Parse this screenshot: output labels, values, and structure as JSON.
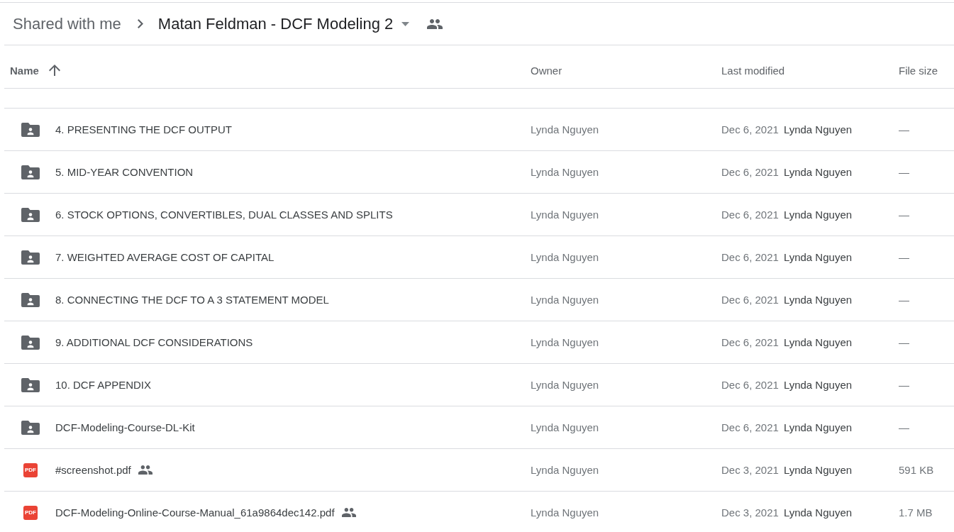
{
  "breadcrumb": [
    {
      "label": "Shared with me",
      "current": false,
      "shared": false
    },
    {
      "label": "Matan Feldman - DCF Modeling 2",
      "current": true,
      "shared": true
    }
  ],
  "columns": [
    {
      "label": "Name",
      "sorted": true
    },
    {
      "label": "Owner",
      "sorted": false
    },
    {
      "label": "Last modified",
      "sorted": false
    },
    {
      "label": "File size",
      "sorted": false
    }
  ],
  "rows": [
    {
      "kind": "folder",
      "name": "4. PRESENTING THE DCF OUTPUT",
      "shared": false,
      "owner": "Lynda Nguyen",
      "modified_date": "Dec 6, 2021",
      "modified_by": "Lynda Nguyen",
      "size": "—"
    },
    {
      "kind": "folder",
      "name": "5. MID-YEAR CONVENTION",
      "shared": false,
      "owner": "Lynda Nguyen",
      "modified_date": "Dec 6, 2021",
      "modified_by": "Lynda Nguyen",
      "size": "—"
    },
    {
      "kind": "folder",
      "name": "6. STOCK OPTIONS, CONVERTIBLES, DUAL CLASSES AND SPLITS",
      "shared": false,
      "owner": "Lynda Nguyen",
      "modified_date": "Dec 6, 2021",
      "modified_by": "Lynda Nguyen",
      "size": "—"
    },
    {
      "kind": "folder",
      "name": "7. WEIGHTED AVERAGE COST OF CAPITAL",
      "shared": false,
      "owner": "Lynda Nguyen",
      "modified_date": "Dec 6, 2021",
      "modified_by": "Lynda Nguyen",
      "size": "—"
    },
    {
      "kind": "folder",
      "name": "8. CONNECTING THE DCF TO A 3 STATEMENT MODEL",
      "shared": false,
      "owner": "Lynda Nguyen",
      "modified_date": "Dec 6, 2021",
      "modified_by": "Lynda Nguyen",
      "size": "—"
    },
    {
      "kind": "folder",
      "name": "9. ADDITIONAL DCF CONSIDERATIONS",
      "shared": false,
      "owner": "Lynda Nguyen",
      "modified_date": "Dec 6, 2021",
      "modified_by": "Lynda Nguyen",
      "size": "—"
    },
    {
      "kind": "folder",
      "name": "10. DCF APPENDIX",
      "shared": false,
      "owner": "Lynda Nguyen",
      "modified_date": "Dec 6, 2021",
      "modified_by": "Lynda Nguyen",
      "size": "—"
    },
    {
      "kind": "folder",
      "name": "DCF-Modeling-Course-DL-Kit",
      "shared": false,
      "owner": "Lynda Nguyen",
      "modified_date": "Dec 6, 2021",
      "modified_by": "Lynda Nguyen",
      "size": "—"
    },
    {
      "kind": "pdf",
      "icon_text": "PDF",
      "name": "#screenshot.pdf",
      "shared": true,
      "owner": "Lynda Nguyen",
      "modified_date": "Dec 3, 2021",
      "modified_by": "Lynda Nguyen",
      "size": "591 KB"
    },
    {
      "kind": "pdf",
      "icon_text": "PDF",
      "name": "DCF-Modeling-Online-Course-Manual_61a9864dec142.pdf",
      "shared": true,
      "owner": "Lynda Nguyen",
      "modified_date": "Dec 3, 2021",
      "modified_by": "Lynda Nguyen",
      "size": "1.7 MB"
    }
  ]
}
